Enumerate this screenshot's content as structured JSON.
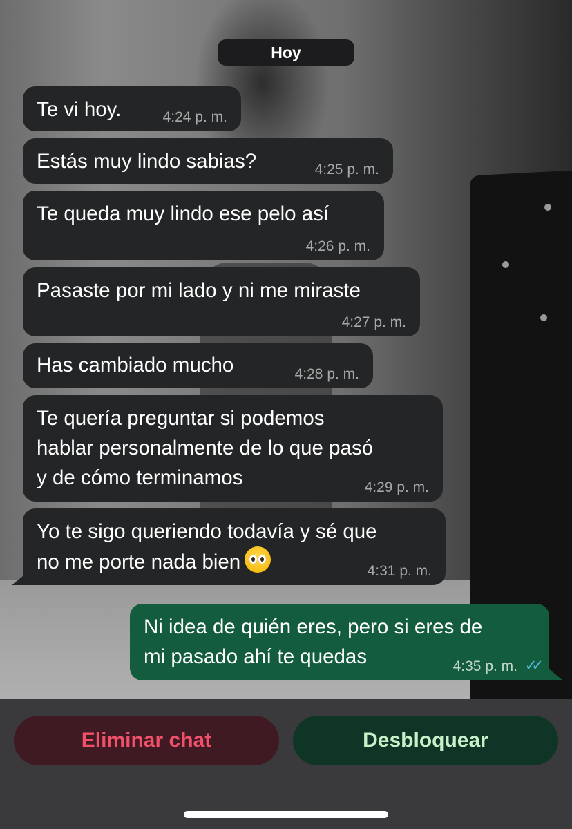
{
  "date_separator": "Hoy",
  "messages": [
    {
      "direction": "in",
      "text": "Te vi hoy.",
      "time": "4:24 p. m."
    },
    {
      "direction": "in",
      "text": "Estás muy lindo sabias?",
      "time": "4:25 p. m."
    },
    {
      "direction": "in",
      "text": "Te queda muy lindo ese pelo así",
      "time": "4:26 p. m."
    },
    {
      "direction": "in",
      "text": "Pasaste por mi lado y ni me miraste",
      "time": "4:27 p. m."
    },
    {
      "direction": "in",
      "text": "Has cambiado mucho",
      "time": "4:28 p. m."
    },
    {
      "direction": "in",
      "text": "Te quería preguntar si podemos\nhablar personalmente de lo que pasó\ny de cómo terminamos",
      "time": "4:29 p. m."
    },
    {
      "direction": "in",
      "text": "Yo te sigo queriendo todavía y sé que\nno me porte nada bien",
      "emoji": "pleading-face-emoji",
      "time": "4:31 p. m."
    },
    {
      "direction": "out",
      "text": "Ni idea de quién eres, pero si eres de\nmi pasado ahí te quedas",
      "time": "4:35 p. m.",
      "status": "read-double-check-icon"
    }
  ],
  "actions": {
    "delete_label": "Eliminar chat",
    "unblock_label": "Desbloquear"
  },
  "colors": {
    "incoming_bubble": "#242526",
    "outgoing_bubble": "#135c3e",
    "delete_text": "#f0506a",
    "unblock_text": "#c6f0c8",
    "read_ticks": "#53bdeb"
  }
}
